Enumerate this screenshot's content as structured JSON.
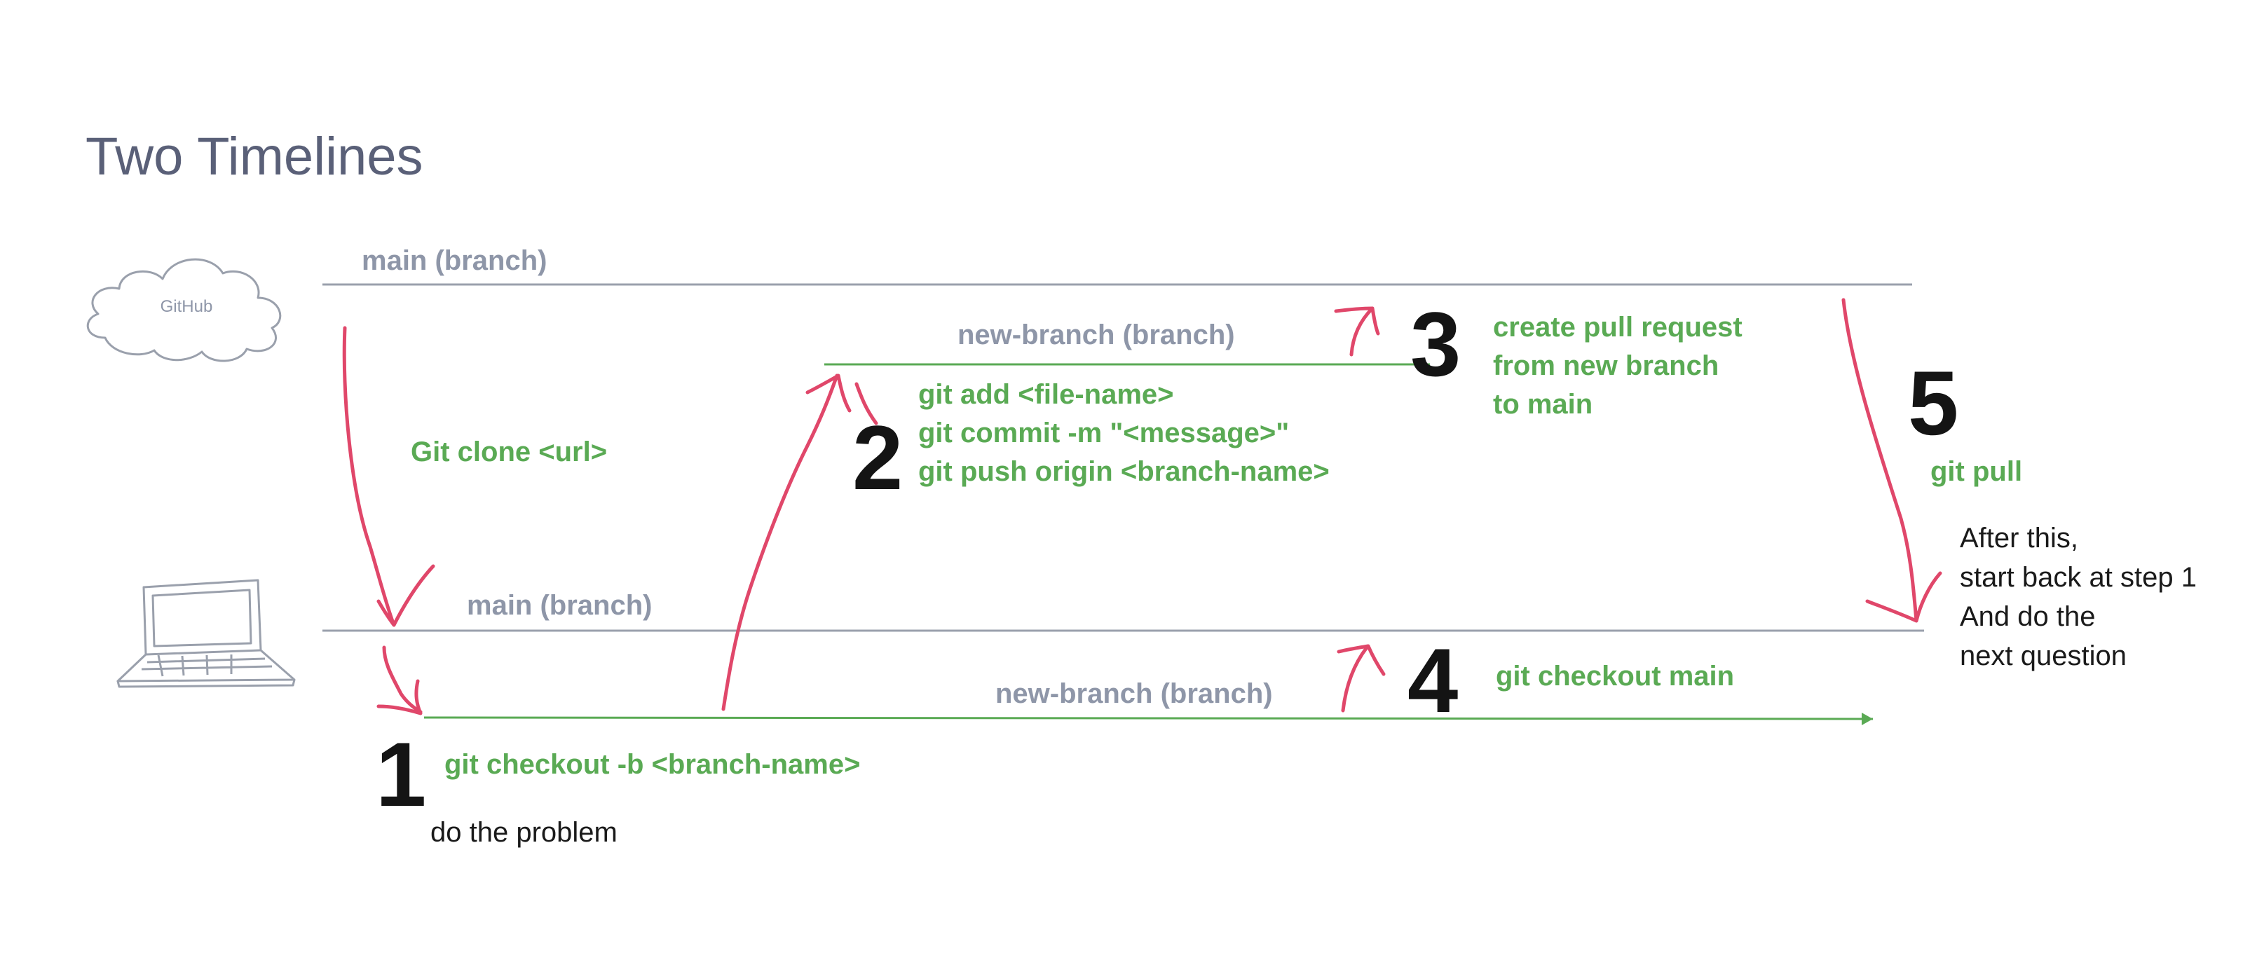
{
  "title": "Two Timelines",
  "github_label": "GitHub",
  "branches": {
    "remote_main": "main (branch)",
    "remote_new": "new-branch (branch)",
    "local_main": "main (branch)",
    "local_new": "new-branch (branch)"
  },
  "steps": [
    {
      "number": "1",
      "lines": [
        "git checkout -b <branch-name>"
      ],
      "note": "do the problem"
    },
    {
      "number": "2",
      "lines": [
        "git add <file-name>",
        "git commit -m \"<message>\"",
        "git push origin <branch-name>"
      ]
    },
    {
      "number": "3",
      "lines": [
        "create pull request",
        "from new branch",
        "to main"
      ]
    },
    {
      "number": "4",
      "lines": [
        "git checkout main"
      ]
    },
    {
      "number": "5",
      "lines": [
        "git pull"
      ],
      "note_lines": [
        "After this,",
        "start back at step 1",
        "And do the",
        "next question"
      ]
    }
  ],
  "clone_label": "Git clone <url>",
  "colors": {
    "arrow": "#e0476a",
    "green": "#5aaa54",
    "gray_line": "#9aa0ac",
    "branch_text": "#8e96a8",
    "title": "#5a6078",
    "number": "#141414"
  },
  "icons": [
    "cloud-icon",
    "laptop-icon"
  ]
}
